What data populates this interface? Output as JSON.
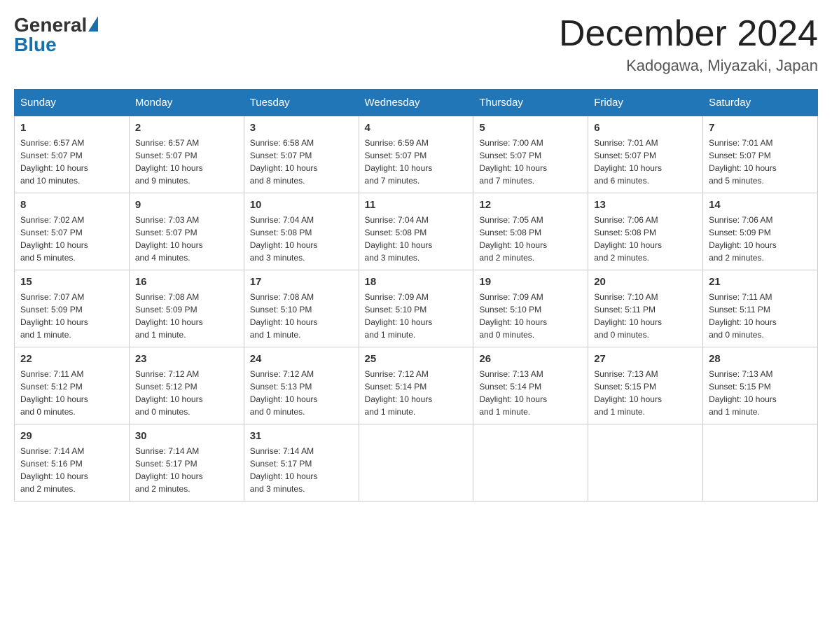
{
  "logo": {
    "general": "General",
    "blue": "Blue"
  },
  "title": {
    "month_year": "December 2024",
    "location": "Kadogawa, Miyazaki, Japan"
  },
  "days_of_week": [
    "Sunday",
    "Monday",
    "Tuesday",
    "Wednesday",
    "Thursday",
    "Friday",
    "Saturday"
  ],
  "weeks": [
    [
      {
        "day": "1",
        "sunrise": "6:57 AM",
        "sunset": "5:07 PM",
        "daylight": "10 hours and 10 minutes."
      },
      {
        "day": "2",
        "sunrise": "6:57 AM",
        "sunset": "5:07 PM",
        "daylight": "10 hours and 9 minutes."
      },
      {
        "day": "3",
        "sunrise": "6:58 AM",
        "sunset": "5:07 PM",
        "daylight": "10 hours and 8 minutes."
      },
      {
        "day": "4",
        "sunrise": "6:59 AM",
        "sunset": "5:07 PM",
        "daylight": "10 hours and 7 minutes."
      },
      {
        "day": "5",
        "sunrise": "7:00 AM",
        "sunset": "5:07 PM",
        "daylight": "10 hours and 7 minutes."
      },
      {
        "day": "6",
        "sunrise": "7:01 AM",
        "sunset": "5:07 PM",
        "daylight": "10 hours and 6 minutes."
      },
      {
        "day": "7",
        "sunrise": "7:01 AM",
        "sunset": "5:07 PM",
        "daylight": "10 hours and 5 minutes."
      }
    ],
    [
      {
        "day": "8",
        "sunrise": "7:02 AM",
        "sunset": "5:07 PM",
        "daylight": "10 hours and 5 minutes."
      },
      {
        "day": "9",
        "sunrise": "7:03 AM",
        "sunset": "5:07 PM",
        "daylight": "10 hours and 4 minutes."
      },
      {
        "day": "10",
        "sunrise": "7:04 AM",
        "sunset": "5:08 PM",
        "daylight": "10 hours and 3 minutes."
      },
      {
        "day": "11",
        "sunrise": "7:04 AM",
        "sunset": "5:08 PM",
        "daylight": "10 hours and 3 minutes."
      },
      {
        "day": "12",
        "sunrise": "7:05 AM",
        "sunset": "5:08 PM",
        "daylight": "10 hours and 2 minutes."
      },
      {
        "day": "13",
        "sunrise": "7:06 AM",
        "sunset": "5:08 PM",
        "daylight": "10 hours and 2 minutes."
      },
      {
        "day": "14",
        "sunrise": "7:06 AM",
        "sunset": "5:09 PM",
        "daylight": "10 hours and 2 minutes."
      }
    ],
    [
      {
        "day": "15",
        "sunrise": "7:07 AM",
        "sunset": "5:09 PM",
        "daylight": "10 hours and 1 minute."
      },
      {
        "day": "16",
        "sunrise": "7:08 AM",
        "sunset": "5:09 PM",
        "daylight": "10 hours and 1 minute."
      },
      {
        "day": "17",
        "sunrise": "7:08 AM",
        "sunset": "5:10 PM",
        "daylight": "10 hours and 1 minute."
      },
      {
        "day": "18",
        "sunrise": "7:09 AM",
        "sunset": "5:10 PM",
        "daylight": "10 hours and 1 minute."
      },
      {
        "day": "19",
        "sunrise": "7:09 AM",
        "sunset": "5:10 PM",
        "daylight": "10 hours and 0 minutes."
      },
      {
        "day": "20",
        "sunrise": "7:10 AM",
        "sunset": "5:11 PM",
        "daylight": "10 hours and 0 minutes."
      },
      {
        "day": "21",
        "sunrise": "7:11 AM",
        "sunset": "5:11 PM",
        "daylight": "10 hours and 0 minutes."
      }
    ],
    [
      {
        "day": "22",
        "sunrise": "7:11 AM",
        "sunset": "5:12 PM",
        "daylight": "10 hours and 0 minutes."
      },
      {
        "day": "23",
        "sunrise": "7:12 AM",
        "sunset": "5:12 PM",
        "daylight": "10 hours and 0 minutes."
      },
      {
        "day": "24",
        "sunrise": "7:12 AM",
        "sunset": "5:13 PM",
        "daylight": "10 hours and 0 minutes."
      },
      {
        "day": "25",
        "sunrise": "7:12 AM",
        "sunset": "5:14 PM",
        "daylight": "10 hours and 1 minute."
      },
      {
        "day": "26",
        "sunrise": "7:13 AM",
        "sunset": "5:14 PM",
        "daylight": "10 hours and 1 minute."
      },
      {
        "day": "27",
        "sunrise": "7:13 AM",
        "sunset": "5:15 PM",
        "daylight": "10 hours and 1 minute."
      },
      {
        "day": "28",
        "sunrise": "7:13 AM",
        "sunset": "5:15 PM",
        "daylight": "10 hours and 1 minute."
      }
    ],
    [
      {
        "day": "29",
        "sunrise": "7:14 AM",
        "sunset": "5:16 PM",
        "daylight": "10 hours and 2 minutes."
      },
      {
        "day": "30",
        "sunrise": "7:14 AM",
        "sunset": "5:17 PM",
        "daylight": "10 hours and 2 minutes."
      },
      {
        "day": "31",
        "sunrise": "7:14 AM",
        "sunset": "5:17 PM",
        "daylight": "10 hours and 3 minutes."
      },
      null,
      null,
      null,
      null
    ]
  ],
  "labels": {
    "sunrise": "Sunrise:",
    "sunset": "Sunset:",
    "daylight": "Daylight:"
  }
}
